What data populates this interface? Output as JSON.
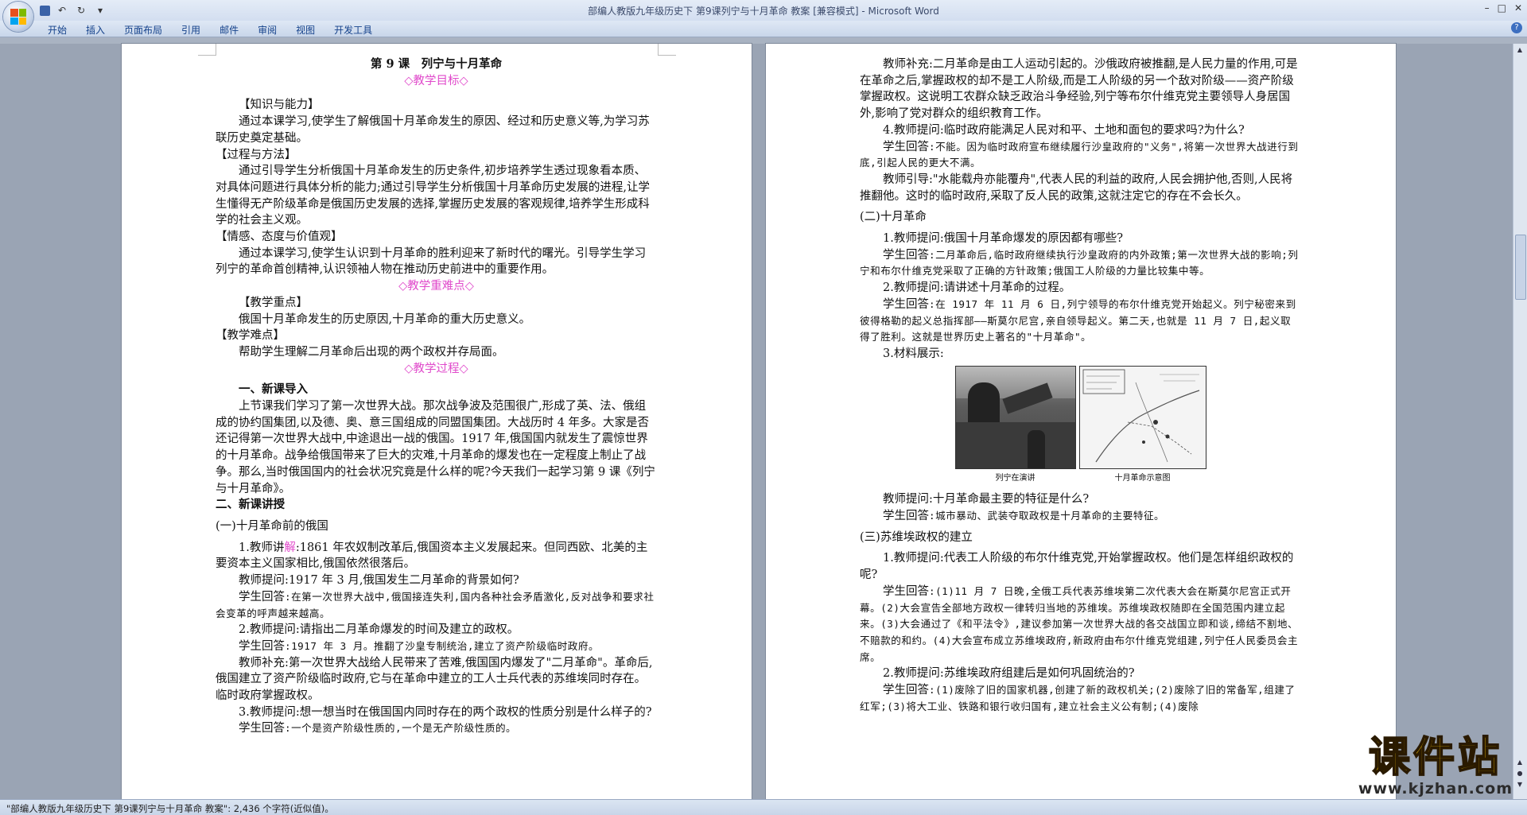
{
  "window": {
    "title": "部编人教版九年级历史下 第9课列宁与十月革命 教案 [兼容模式] - Microsoft Word",
    "controls": [
      "–",
      "□",
      "✕"
    ]
  },
  "ribbon": {
    "tabs": [
      "开始",
      "插入",
      "页面布局",
      "引用",
      "邮件",
      "审阅",
      "视图",
      "开发工具"
    ],
    "help": "?"
  },
  "qat": {
    "save_icon": "save-icon",
    "undo": "↶",
    "redo": "↻",
    "more": "▾"
  },
  "page1": {
    "title": "第 9 课　列宁与十月革命",
    "goal_heading": "◇教学目标◇",
    "knowledge_heading": "【知识与能力】",
    "knowledge_text": "通过本课学习,使学生了解俄国十月革命发生的原因、经过和历史意义等,为学习苏联历史奠定基础。",
    "process_heading": "【过程与方法】",
    "process_text": "通过引导学生分析俄国十月革命发生的历史条件,初步培养学生透过现象看本质、对具体问题进行具体分析的能力;通过引导学生分析俄国十月革命历史发展的进程,让学生懂得无产阶级革命是俄国历史发展的选择,掌握历史发展的客观规律,培养学生形成科学的社会主义观。",
    "emotion_heading": "【情感、态度与价值观】",
    "emotion_text": "通过本课学习,使学生认识到十月革命的胜利迎来了新时代的曙光。引导学生学习列宁的革命首创精神,认识领袖人物在推动历史前进中的重要作用。",
    "key_heading": "◇教学重难点◇",
    "focus_heading": "【教学重点】",
    "focus_text": "俄国十月革命发生的历史原因,十月革命的重大历史意义。",
    "difficulty_heading": "【教学难点】",
    "difficulty_text": "帮助学生理解二月革命后出现的两个政权并存局面。",
    "process_title": "◇教学过程◇",
    "intro_heading": "一、新课导入",
    "intro_text": "上节课我们学习了第一次世界大战。那次战争波及范围很广,形成了英、法、俄组成的协约国集团,以及德、奥、意三国组成的同盟国集团。大战历时 4 年多。大家是否还记得第一次世界大战中,中途退出一战的俄国。1917 年,俄国国内就发生了震惊世界的十月革命。战争给俄国带来了巨大的灾难,十月革命的爆发也在一定程度上制止了战争。那么,当时俄国国内的社会状况究竟是什么样的呢?今天我们一起学习第 9 课《列宁与十月革命》。",
    "new_heading": "二、新课讲授",
    "sec1_heading": "(一)十月革命前的俄国",
    "t1_prefix": "1.教师讲",
    "t1_pink": "解",
    "t1_rest": ":1861 年农奴制改革后,俄国资本主义发展起来。但同西欧、北美的主要资本主义国家相比,俄国依然很落后。",
    "q1": "教师提问:1917 年 3 月,俄国发生二月革命的背景如何?",
    "a1_label": "学生回答",
    "a1": ":在第一次世界大战中,俄国接连失利,国内各种社会矛盾激化,反对战争和要求社会变革的呼声越来越高。",
    "q2": "2.教师提问:请指出二月革命爆发的时间及建立的政权。",
    "a2_label": "学生回答",
    "a2": ":1917 年 3 月。推翻了沙皇专制统治,建立了资产阶级临时政府。",
    "s2": "教师补充:第一次世界大战给人民带来了苦难,俄国国内爆发了\"二月革命\"。革命后,俄国建立了资产阶级临时政府,它与在革命中建立的工人士兵代表的苏维埃同时存在。临时政府掌握政权。",
    "q3": "3.教师提问:想一想当时在俄国国内同时存在的两个政权的性质分别是什么样子的?",
    "a3_label": "学生回答",
    "a3": ":一个是资产阶级性质的,一个是无产阶级性质的。"
  },
  "page2": {
    "s1": "教师补充:二月革命是由工人运动引起的。沙俄政府被推翻,是人民力量的作用,可是在革命之后,掌握政权的却不是工人阶级,而是工人阶级的另一个敌对阶级——资产阶级掌握政权。这说明工农群众缺乏政治斗争经验,列宁等布尔什维克党主要领导人身居国外,影响了党对群众的组织教育工作。",
    "q4": "4.教师提问:临时政府能满足人民对和平、土地和面包的要求吗?为什么?",
    "a4_label": "学生回答",
    "a4": ":不能。因为临时政府宣布继续履行沙皇政府的\"义务\",将第一次世界大战进行到底,引起人民的更大不满。",
    "g1": "教师引导:\"水能载舟亦能覆舟\",代表人民的利益的政府,人民会拥护他,否则,人民将推翻他。这时的临时政府,采取了反人民的政策,这就注定它的存在不会长久。",
    "sec2_heading": "(二)十月革命",
    "q5": "1.教师提问:俄国十月革命爆发的原因都有哪些?",
    "a5_label": "学生回答",
    "a5": ":二月革命后,临时政府继续执行沙皇政府的内外政策;第一次世界大战的影响;列宁和布尔什维克党采取了正确的方针政策;俄国工人阶级的力量比较集中等。",
    "q6": "2.教师提问:请讲述十月革命的过程。",
    "a6_label": "学生回答",
    "a6": ":在 1917 年 11 月 6 日,列宁领导的布尔什维克党开始起义。列宁秘密来到彼得格勒的起义总指挥部——斯莫尔尼宫,亲自领导起义。第二天,也就是 11 月 7 日,起义取得了胜利。这就是世界历史上著名的\"十月革命\"。",
    "m3": "3.材料展示:",
    "fig1_cap": "列宁在演讲",
    "fig2_cap": "十月革命示意图",
    "q7": "教师提问:十月革命最主要的特征是什么?",
    "a7_label": "学生回答",
    "a7": ":城市暴动、武装夺取政权是十月革命的主要特征。",
    "sec3_heading": "(三)苏维埃政权的建立",
    "q8": "1.教师提问:代表工人阶级的布尔什维克党,开始掌握政权。他们是怎样组织政权的呢?",
    "a8_label": "学生回答",
    "a8": ":(1)11 月 7 日晚,全俄工兵代表苏维埃第二次代表大会在斯莫尔尼宫正式开幕。(2)大会宣告全部地方政权一律转归当地的苏维埃。苏维埃政权随即在全国范围内建立起来。(3)大会通过了《和平法令》,建议参加第一次世界大战的各交战国立即和谈,缔结不割地、不赔款的和约。(4)大会宣布成立苏维埃政府,新政府由布尔什维克党组建,列宁任人民委员会主席。",
    "q9": "2.教师提问:苏维埃政府组建后是如何巩固统治的?",
    "a9_label": "学生回答",
    "a9": ":(1)废除了旧的国家机器,创建了新的政权机关;(2)废除了旧的常备军,组建了红军;(3)将大工业、铁路和银行收归国有,建立社会主义公有制;(4)废除"
  },
  "status": {
    "text": "\"部编人教版九年级历史下 第9课列宁与十月革命 教案\": 2,436 个字符(近似值)。"
  },
  "watermark": {
    "big": "课件站",
    "small": "www.kjzhan.com"
  },
  "colors": {
    "pink": "#e04acb",
    "ribbon_text": "#15428b",
    "watermark_yellow": "#f2c10c"
  }
}
